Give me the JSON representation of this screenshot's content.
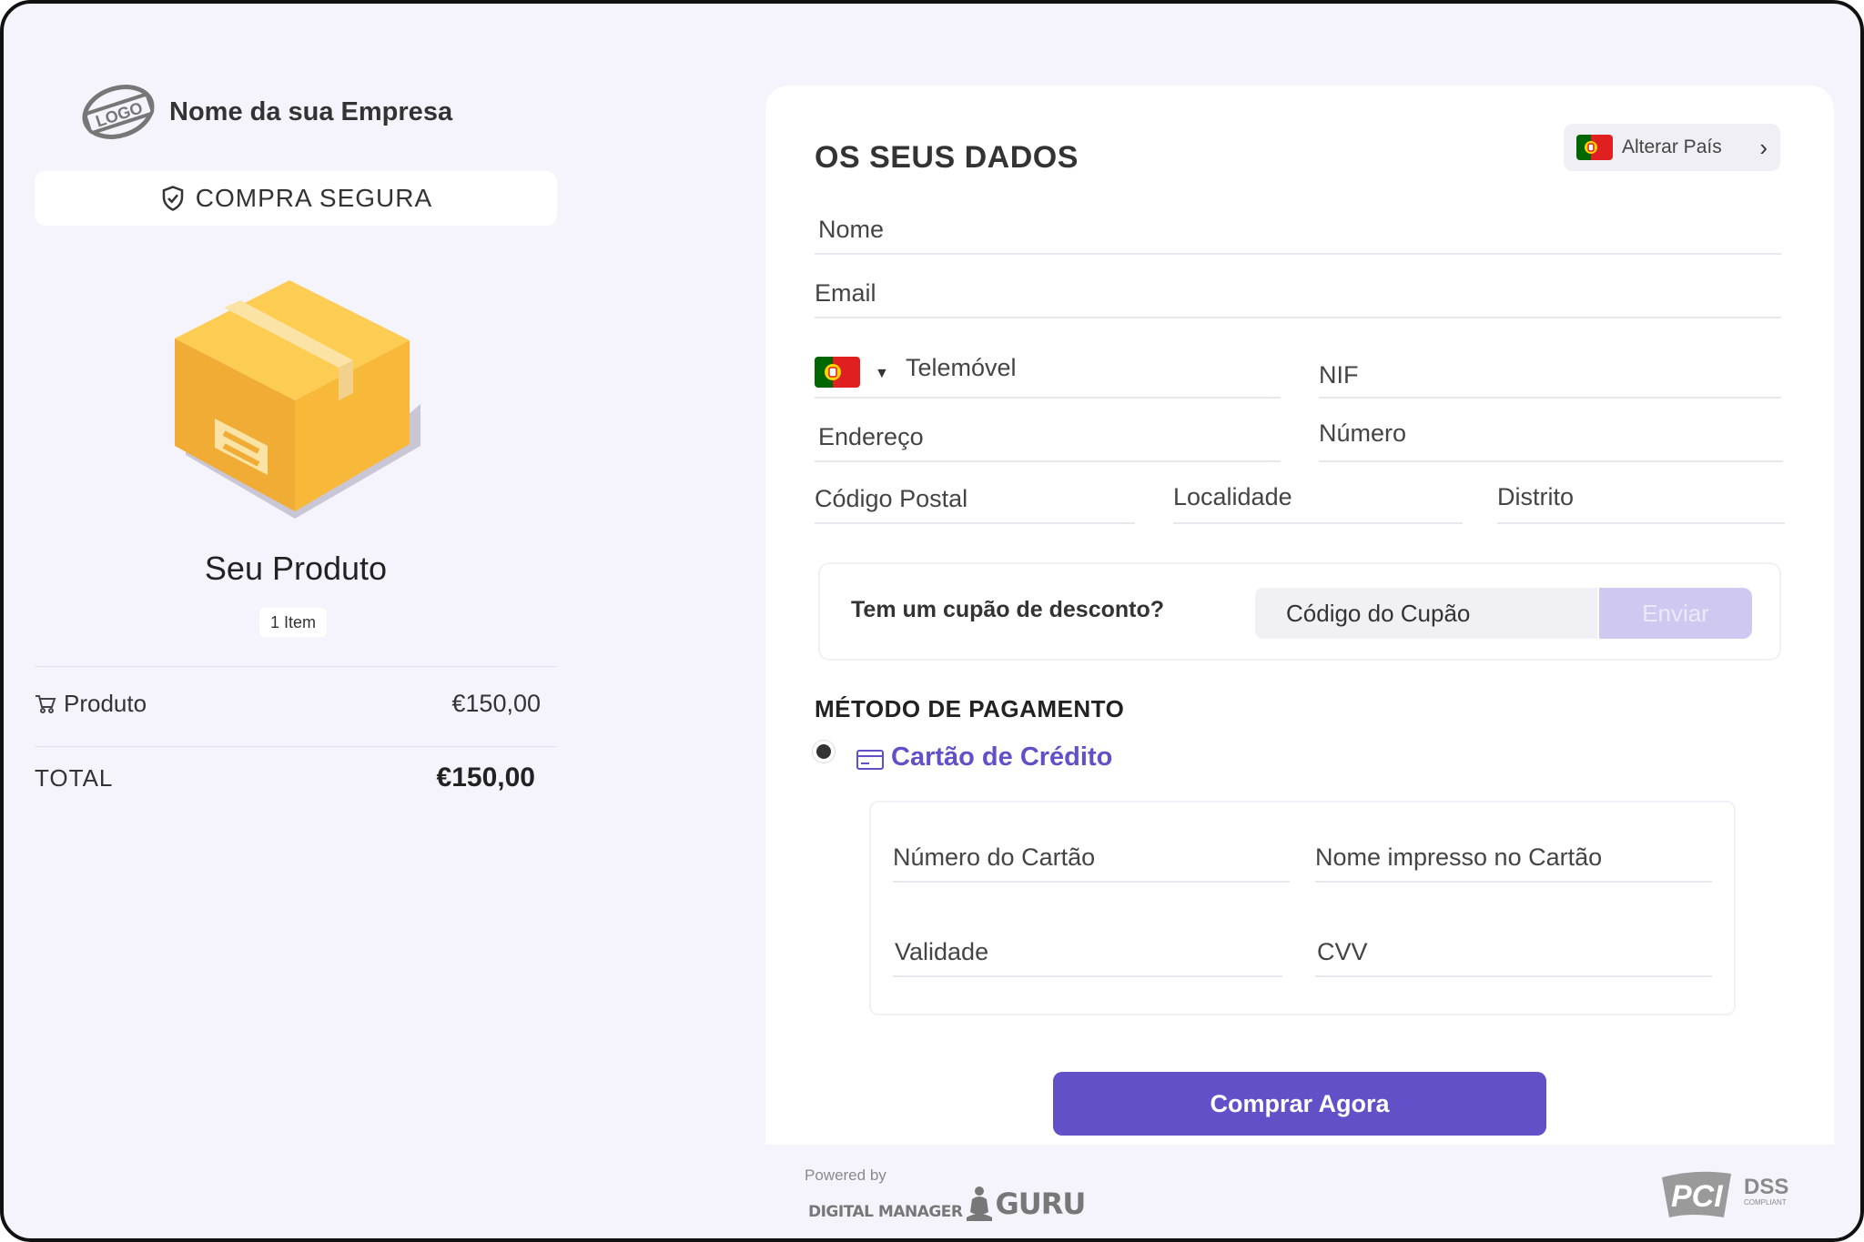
{
  "brand": {
    "name": "Nome da sua Empresa",
    "logo_text": "LOGO"
  },
  "secure_label": "COMPRA SEGURA",
  "product": {
    "name": "Seu Produto",
    "badge": "1 Item"
  },
  "summary": {
    "line_label": "Produto",
    "line_value": "€150,00",
    "total_label": "TOTAL",
    "total_value": "€150,00"
  },
  "form": {
    "title": "OS SEUS DADOS",
    "country_button": "Alterar País",
    "fields": {
      "name": "Nome",
      "email": "Email",
      "phone": "Telemóvel",
      "nif": "NIF",
      "address": "Endereço",
      "number": "Número",
      "postal_code": "Código Postal",
      "locality": "Localidade",
      "district": "Distrito"
    },
    "coupon": {
      "question": "Tem um cupão de desconto?",
      "placeholder": "Código do Cupão",
      "button": "Enviar"
    }
  },
  "payment": {
    "title": "MÉTODO DE PAGAMENTO",
    "method": "Cartão de Crédito",
    "fields": {
      "card_number": "Número do Cartão",
      "card_name": "Nome impresso no Cartão",
      "expiry": "Validade",
      "cvv": "CVV"
    },
    "buy_button": "Comprar Agora"
  },
  "footer": {
    "powered_by": "Powered by",
    "brand_part1": "DIGITAL MANAGER",
    "brand_part2": "GURU",
    "pci_text": "PCI",
    "dss_text": "DSS",
    "dss_sub": "COMPLIANT"
  },
  "colors": {
    "accent": "#6150c8",
    "accent_light": "#cfc9f2",
    "background": "#f5f4fd",
    "box": "#f7b731"
  },
  "icons": [
    "logo-icon",
    "shield-check-icon",
    "package-box-icon",
    "cart-icon",
    "portugal-flag-icon",
    "caret-down-icon",
    "chevron-right-icon",
    "credit-card-icon",
    "pci-dss-icon"
  ]
}
